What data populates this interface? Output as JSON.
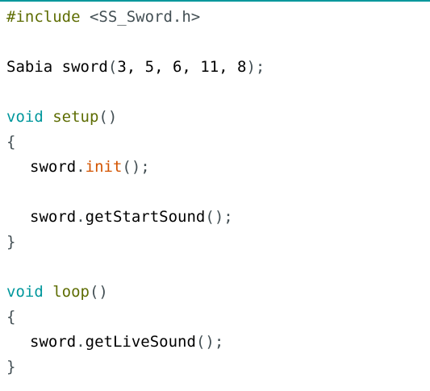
{
  "accent_color": "#00979c",
  "code": {
    "line1": {
      "directive": "#include",
      "space": " ",
      "path": "<SS_Sword.h>"
    },
    "line2": {
      "class_name": "Sabia",
      "space": " ",
      "object": "sword",
      "open": "(",
      "args": "3, 5, 6, 11, 8",
      "close": ");"
    },
    "line3": {
      "type": "void",
      "space": " ",
      "name": "setup",
      "parens": "()"
    },
    "line4": {
      "brace": "{"
    },
    "line5": {
      "object": "sword",
      "dot": ".",
      "method": "init",
      "call": "();"
    },
    "line6": {
      "object": "sword",
      "dot": ".",
      "method": "getStartSound",
      "call": "();"
    },
    "line7": {
      "brace": "}"
    },
    "line8": {
      "type": "void",
      "space": " ",
      "name": "loop",
      "parens": "()"
    },
    "line9": {
      "brace": "{"
    },
    "line10": {
      "object": "sword",
      "dot": ".",
      "method": "getLiveSound",
      "call": "();"
    },
    "line11": {
      "brace": "}"
    }
  }
}
